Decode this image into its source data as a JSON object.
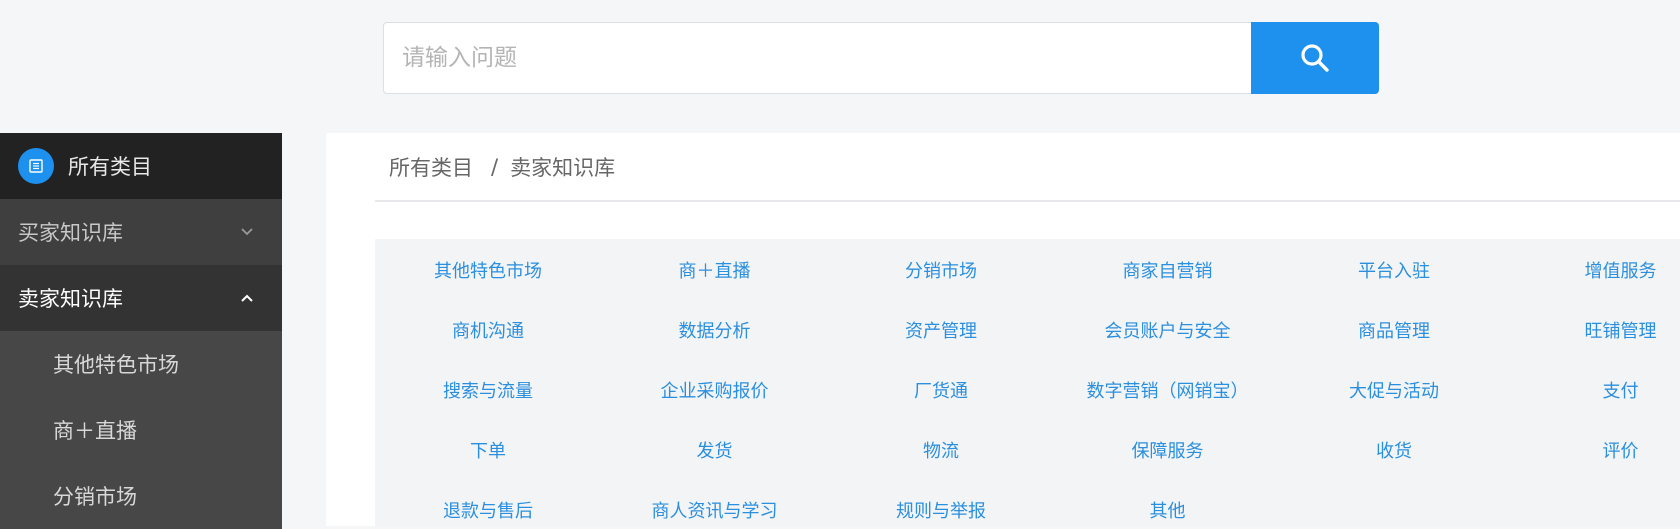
{
  "search": {
    "placeholder": "请输入问题",
    "value": ""
  },
  "sidebar": {
    "header_label": "所有类目",
    "groups": [
      {
        "label": "买家知识库",
        "state": "collapsed"
      },
      {
        "label": "卖家知识库",
        "state": "expanded"
      }
    ],
    "sub_items": [
      {
        "label": "其他特色市场"
      },
      {
        "label": "商＋直播"
      },
      {
        "label": "分销市场"
      }
    ]
  },
  "breadcrumb": {
    "root": "所有类目",
    "separator": "/",
    "current": "卖家知识库"
  },
  "categories": [
    [
      "其他特色市场",
      "商＋直播",
      "分销市场",
      "商家自营销",
      "平台入驻",
      "增值服务"
    ],
    [
      "商机沟通",
      "数据分析",
      "资产管理",
      "会员账户与安全",
      "商品管理",
      "旺铺管理"
    ],
    [
      "搜索与流量",
      "企业采购报价",
      "厂货通",
      "数字营销（网销宝）",
      "大促与活动",
      "支付"
    ],
    [
      "下单",
      "发货",
      "物流",
      "保障服务",
      "收货",
      "评价"
    ],
    [
      "退款与售后",
      "商人资讯与学习",
      "规则与举报",
      "其他"
    ]
  ],
  "colors": {
    "accent": "#1e90ee",
    "link": "#2a8fdf",
    "sidebar_bg": "#3f3f3f",
    "sidebar_header_bg": "#222222"
  },
  "icons": {
    "search_button": "search-icon",
    "sidebar_header": "list-icon",
    "collapsed_group": "chevron-down-icon",
    "expanded_group": "chevron-up-icon"
  }
}
